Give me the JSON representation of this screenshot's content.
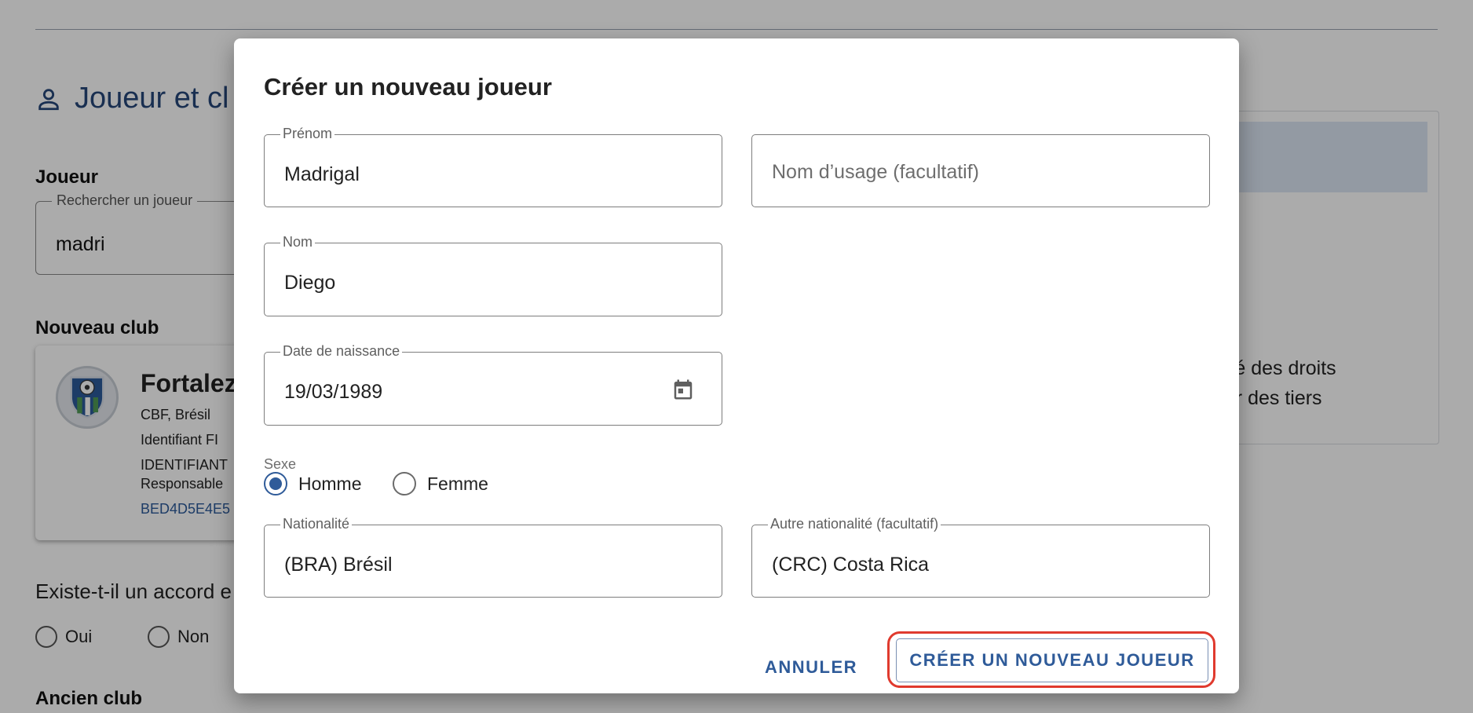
{
  "background": {
    "section_title": "Joueur et cl",
    "joueur_label": "Joueur",
    "search_legend": "Rechercher un joueur",
    "search_value": "madri",
    "new_club_label": "Nouveau club",
    "club_name": "Fortalez",
    "club_federation": "CBF, Brésil",
    "club_fifa_id": "Identifiant FI",
    "club_identifiant": "IDENTIFIANT",
    "club_responsable": "Responsable",
    "club_code": "BED4D5E4E5",
    "question": "Existe-t-il un accord e",
    "radio_oui": "Oui",
    "radio_non": "Non",
    "old_club_label": "Ancien club",
    "right_text_1": "iété des droits",
    "right_text_2": "par des tiers"
  },
  "modal": {
    "title": "Créer un nouveau joueur",
    "prenom": {
      "label": "Prénom",
      "value": "Madrigal"
    },
    "nom_usage": {
      "placeholder": "Nom d’usage (facultatif)"
    },
    "nom": {
      "label": "Nom",
      "value": "Diego"
    },
    "date_naissance": {
      "label": "Date de naissance",
      "value": "19/03/1989"
    },
    "sexe": {
      "label": "Sexe",
      "options": [
        "Homme",
        "Femme"
      ],
      "selected": "Homme"
    },
    "nationalite": {
      "label": "Nationalité",
      "value": "(BRA) Brésil"
    },
    "autre_nationalite": {
      "label": "Autre nationalité (facultatif)",
      "value": "(CRC) Costa Rica"
    },
    "cancel_label": "ANNULER",
    "create_label": "CRÉER UN NOUVEAU JOUEUR"
  },
  "colors": {
    "accent": "#2f5b99",
    "highlight": "#e03a2e",
    "overlay": "rgba(0,0,0,0.33)"
  },
  "icons": {
    "section": "person-icon",
    "date": "calendar-icon",
    "crest": "club-crest-icon"
  }
}
